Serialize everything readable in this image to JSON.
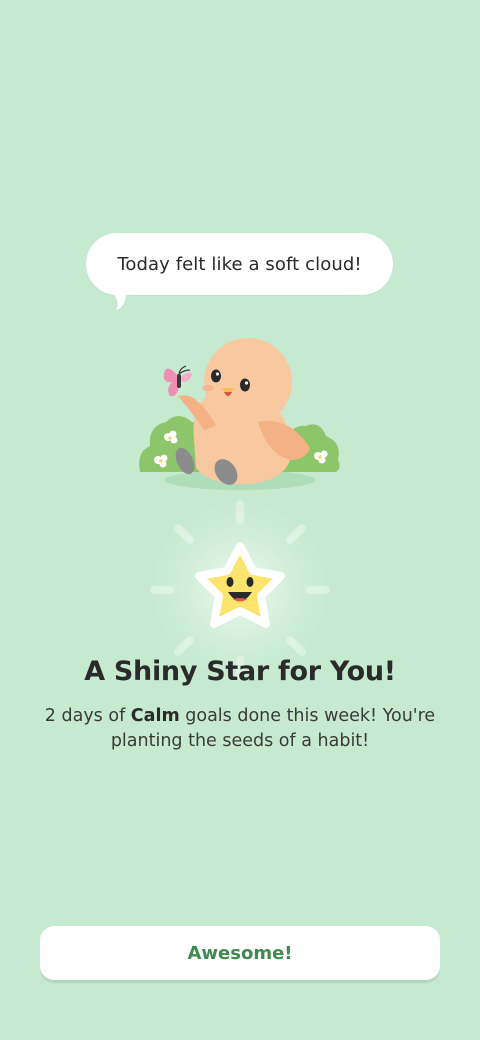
{
  "speech_bubble": {
    "text": "Today felt like a soft cloud!"
  },
  "reward": {
    "title": "A Shiny Star for You!",
    "message_prefix": "2 days of ",
    "goal_name": "Calm",
    "message_suffix": " goals done this week! You're planting the seeds of a habit!"
  },
  "cta": {
    "label": "Awesome!"
  },
  "colors": {
    "background": "#c6ead0",
    "accent_green": "#3f8a4e",
    "star_yellow": "#fde46c",
    "bird_peach": "#f8c8a0",
    "bush_green": "#8dc56b",
    "butterfly_pink": "#ef8fb6"
  },
  "icons": [
    "bird-mascot-illustration",
    "butterfly-icon",
    "bush-icon",
    "smiling-star-icon"
  ]
}
